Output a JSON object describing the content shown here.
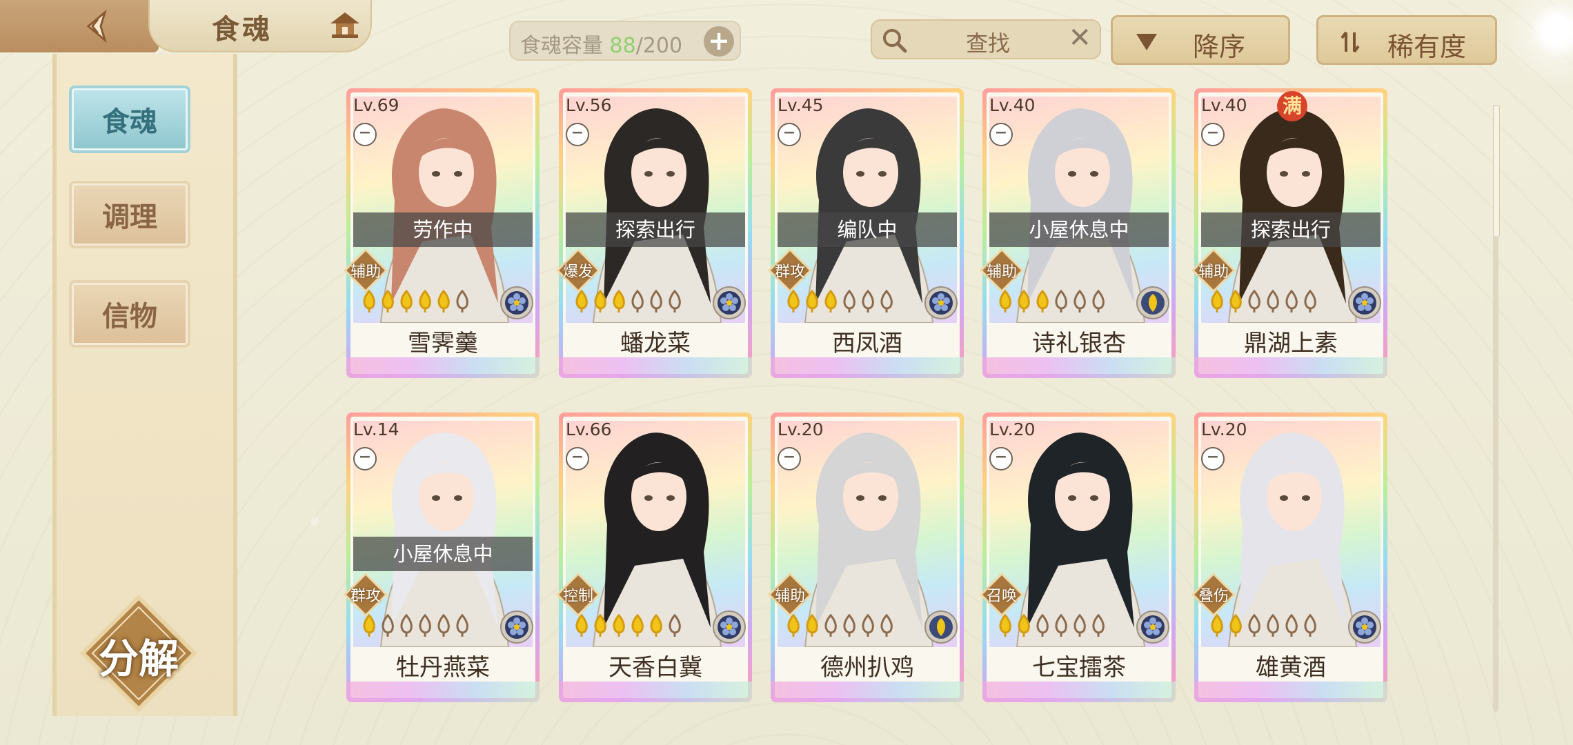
{
  "header": {
    "title": "食魂",
    "capacity_label": "食魂容量",
    "capacity_current": "88",
    "capacity_max": "/200",
    "capacity_add": "+",
    "search_placeholder": "查找",
    "search_clear": "✕",
    "sort_label": "降序",
    "rarity_label": "稀有度"
  },
  "sidebar": {
    "tabs": [
      {
        "label": "食魂",
        "active": true
      },
      {
        "label": "调理",
        "active": false
      },
      {
        "label": "信物",
        "active": false
      }
    ],
    "decompose_label": "分解"
  },
  "colors": {
    "spoon_full": "#f1c419",
    "spoon_empty": "#8b6a4b",
    "accent_teal": "#8fc6cf"
  },
  "cards": [
    {
      "level": "Lv.69",
      "status": "劳作中",
      "role": "辅助",
      "name": "雪霁羹",
      "stars": 5,
      "hair": "#c9866e",
      "element": "dark-flower"
    },
    {
      "level": "Lv.56",
      "status": "探索出行",
      "role": "爆发",
      "name": "蟠龙菜",
      "stars": 3,
      "hair": "#2b2826",
      "element": "dark-flower"
    },
    {
      "level": "Lv.45",
      "status": "编队中",
      "role": "群攻",
      "name": "西凤酒",
      "stars": 3,
      "hair": "#3a3a3a",
      "element": "dark-flower"
    },
    {
      "level": "Lv.40",
      "status": "小屋休息中",
      "role": "辅助",
      "name": "诗礼银杏",
      "stars": 3,
      "hair": "#cfcfd6",
      "element": "gold-leaf"
    },
    {
      "level": "Lv.40",
      "status": "探索出行",
      "role": "辅助",
      "name": "鼎湖上素",
      "stars": 2,
      "hair": "#3a2a1c",
      "element": "dark-flower",
      "full_badge": "满"
    },
    {
      "level": "Lv.14",
      "status": "小屋休息中",
      "role": "群攻",
      "name": "牡丹燕菜",
      "stars": 1,
      "hair": "#e9e9ee",
      "element": "dark-flower"
    },
    {
      "level": "Lv.66",
      "status": "",
      "role": "控制",
      "name": "天香白冀",
      "stars": 5,
      "hair": "#222020",
      "element": "dark-flower"
    },
    {
      "level": "Lv.20",
      "status": "",
      "role": "辅助",
      "name": "德州扒鸡",
      "stars": 2,
      "hair": "#d5d5d5",
      "element": "gold-leaf"
    },
    {
      "level": "Lv.20",
      "status": "",
      "role": "召唤",
      "name": "七宝擂茶",
      "stars": 2,
      "hair": "#1e2428",
      "element": "dark-flower"
    },
    {
      "level": "Lv.20",
      "status": "",
      "role": "叠伤",
      "name": "雄黄酒",
      "stars": 2,
      "hair": "#e4e4ea",
      "element": "dark-flower"
    }
  ]
}
